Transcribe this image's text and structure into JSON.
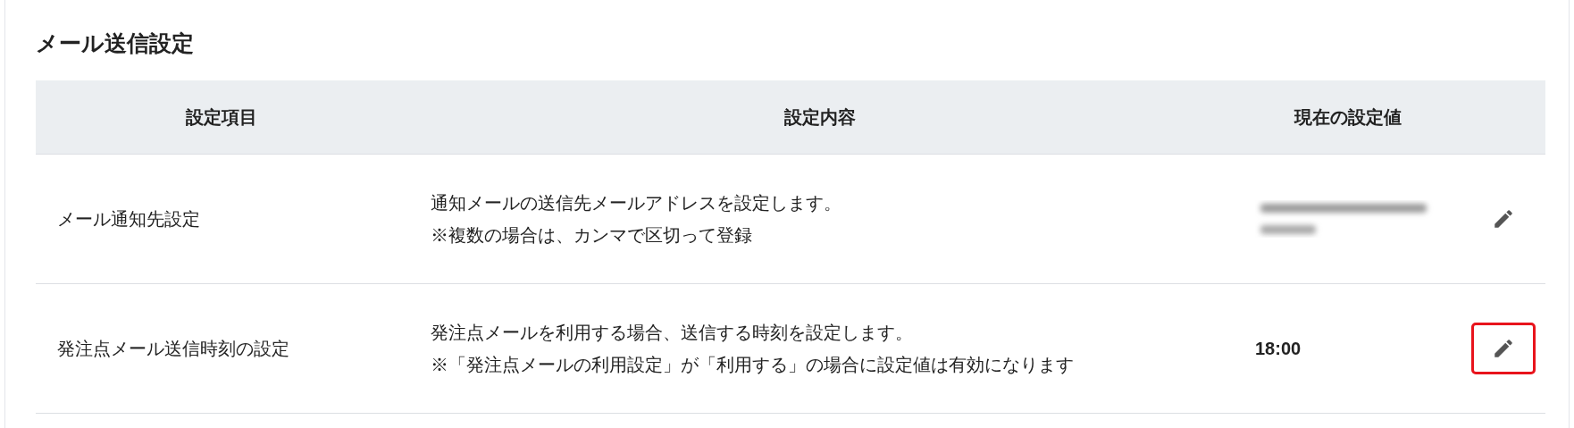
{
  "title": "メール送信設定",
  "table": {
    "columns": [
      "設定項目",
      "設定内容",
      "現在の設定値"
    ],
    "rows": [
      {
        "item": "メール通知先設定",
        "description": [
          "通知メールの送信先メールアドレスを設定します。",
          "※複数の場合は、カンマで区切って登録"
        ],
        "kind": "redacted",
        "highlighted": false
      },
      {
        "item": "発注点メール送信時刻の設定",
        "description": [
          "発注点メールを利用する場合、送信する時刻を設定します。",
          "※「発注点メールの利用設定」が「利用する」の場合に設定値は有効になります"
        ],
        "kind": "text",
        "value": "18:00",
        "highlighted": true
      }
    ]
  }
}
